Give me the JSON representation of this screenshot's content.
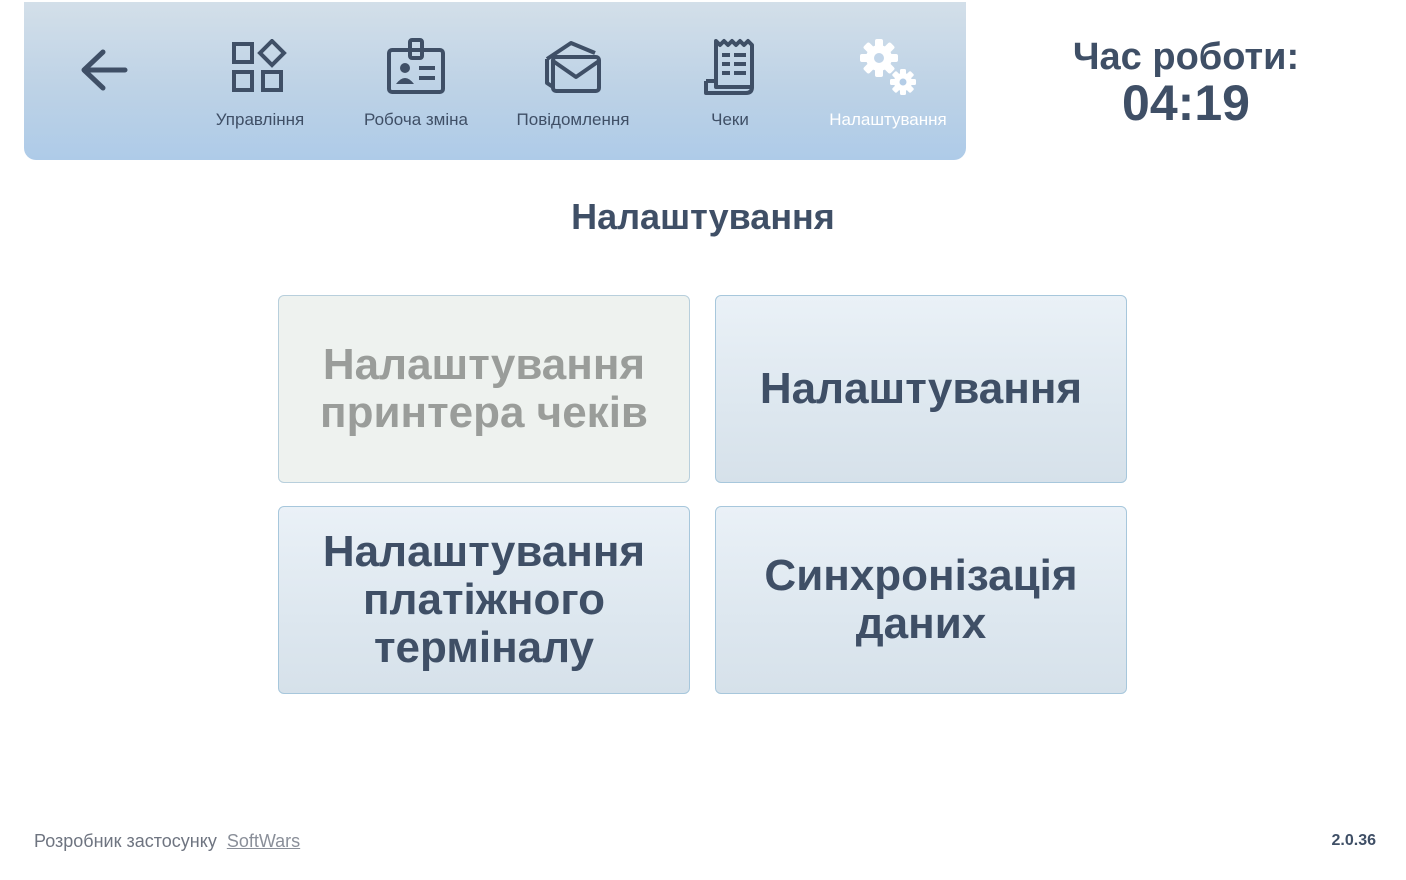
{
  "toolbar": {
    "items": [
      {
        "label": "Управління",
        "icon": "management-grid-icon"
      },
      {
        "label": "Робоча зміна",
        "icon": "id-badge-icon"
      },
      {
        "label": "Повідомлення",
        "icon": "envelope-icon"
      },
      {
        "label": "Чеки",
        "icon": "receipt-icon"
      },
      {
        "label": "Налаштування",
        "icon": "gears-icon",
        "active": true
      }
    ],
    "back_icon": "arrow-left-icon"
  },
  "worktime": {
    "label": "Час роботи:",
    "value": "04:19"
  },
  "page": {
    "title": "Налаштування"
  },
  "tiles": [
    {
      "label": "Налаштування\nпринтера чеків",
      "disabled": true
    },
    {
      "label": "Налаштування",
      "disabled": false
    },
    {
      "label": "Налаштування\nплатіжного\nтерміналу",
      "disabled": false
    },
    {
      "label": "Синхронізація\nданих",
      "disabled": false
    }
  ],
  "footer": {
    "developer_label": "Розробник застосунку",
    "developer_link": "SoftWars",
    "version": "2.0.36"
  },
  "colors": {
    "text": "#3f4f66",
    "toolbar_top": "#d3dfe9",
    "toolbar_bottom": "#aecbe8",
    "tile_border": "#a7c7dc",
    "disabled_text": "#9a9d9a"
  }
}
